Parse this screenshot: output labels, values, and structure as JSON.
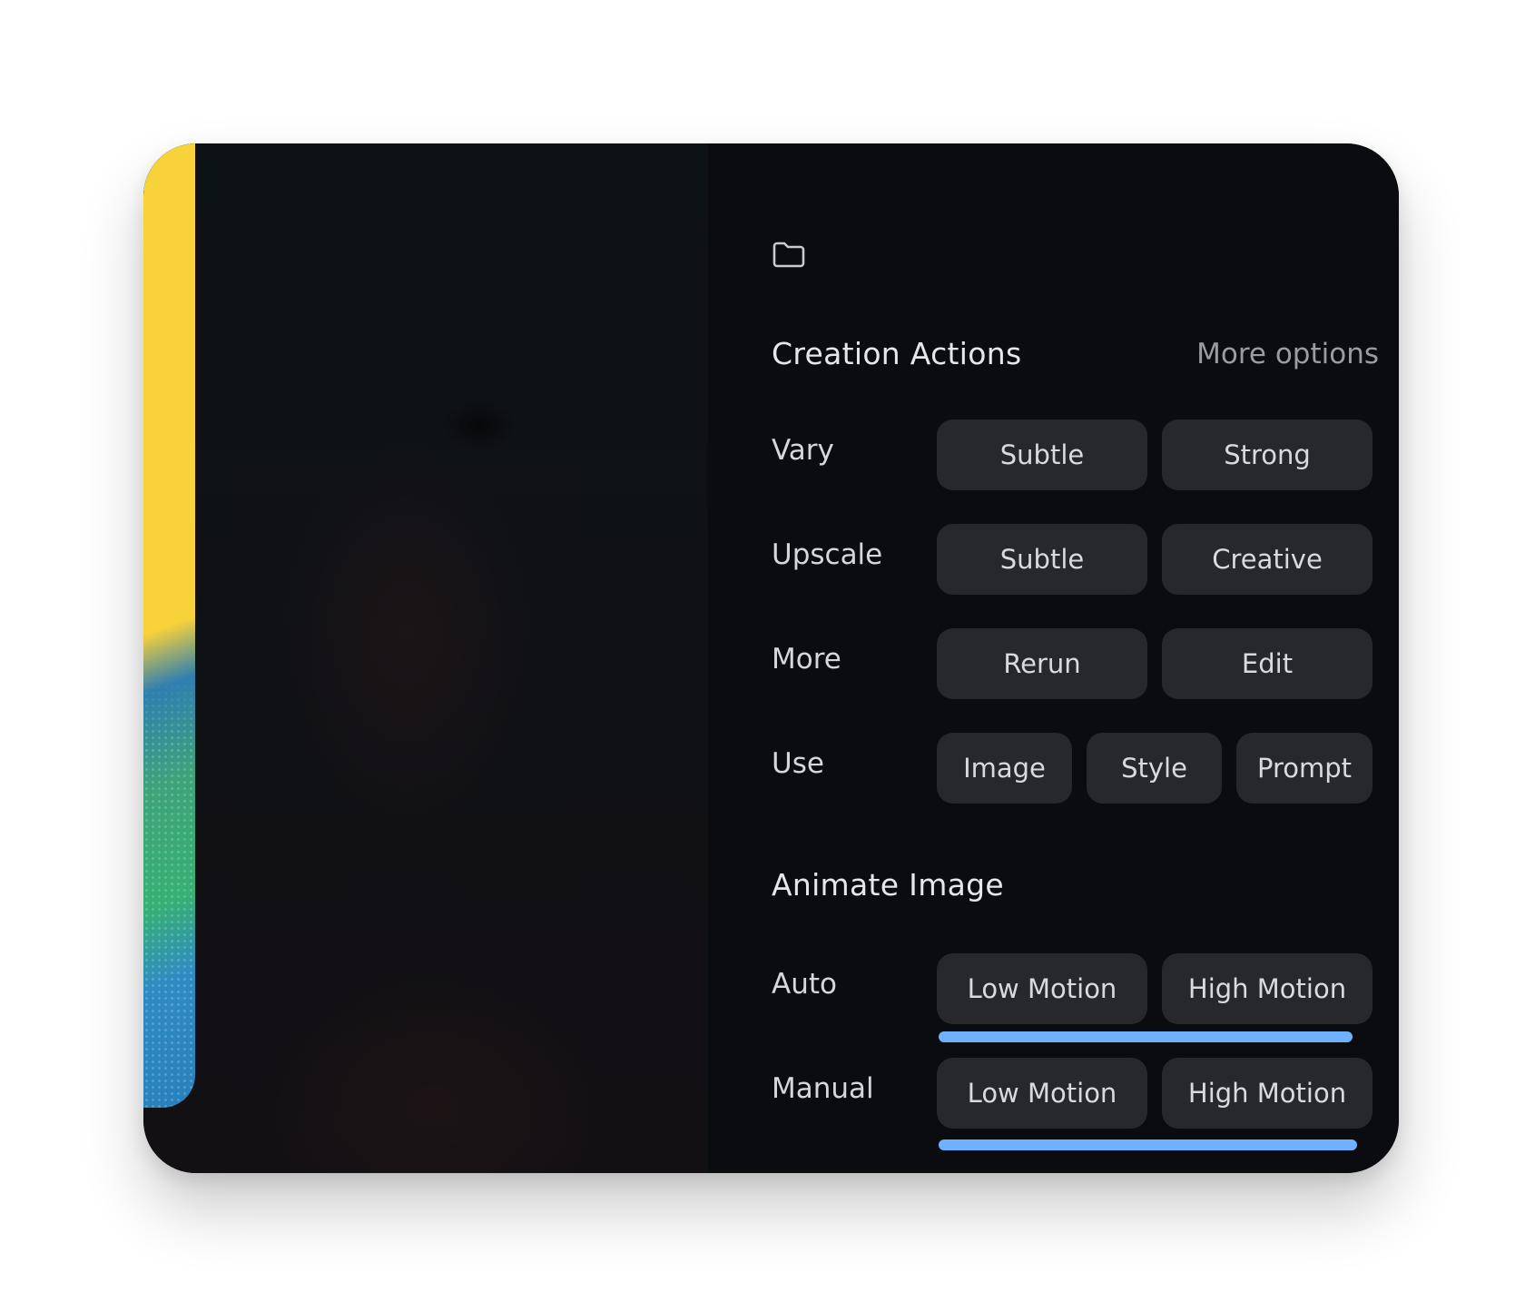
{
  "panel": {
    "sections": {
      "creation": {
        "title": "Creation Actions",
        "more_options": "More options",
        "rows": [
          {
            "label": "Vary",
            "buttons": [
              "Subtle",
              "Strong"
            ]
          },
          {
            "label": "Upscale",
            "buttons": [
              "Subtle",
              "Creative"
            ]
          },
          {
            "label": "More",
            "buttons": [
              "Rerun",
              "Edit"
            ]
          },
          {
            "label": "Use",
            "buttons": [
              "Image",
              "Style",
              "Prompt"
            ]
          }
        ]
      },
      "animate": {
        "title": "Animate Image",
        "rows": [
          {
            "label": "Auto",
            "buttons": [
              "Low Motion",
              "High Motion"
            ],
            "progress_percent": 95
          },
          {
            "label": "Manual",
            "buttons": [
              "Low Motion",
              "High Motion"
            ],
            "progress_percent": 96
          }
        ]
      }
    }
  },
  "colors": {
    "accent_progress": "#6fb0ff",
    "button_bg": "#27282d",
    "panel_bg": "#0b0c10",
    "strip_yellow": "#f8d23a"
  },
  "icons": {
    "folder": "folder-icon"
  }
}
